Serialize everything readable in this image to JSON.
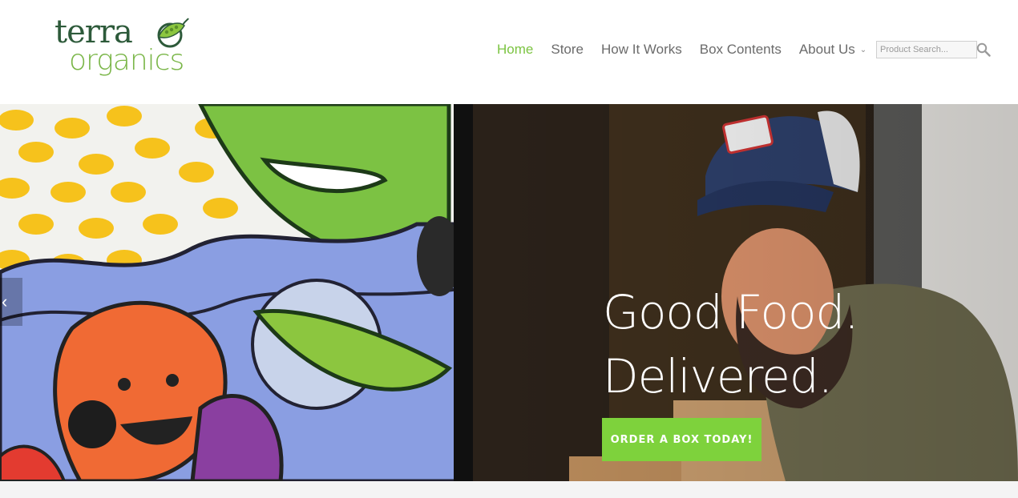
{
  "logo": {
    "line1": "terra",
    "line2": "organics"
  },
  "nav": {
    "items": [
      {
        "label": "Home",
        "active": true
      },
      {
        "label": "Store"
      },
      {
        "label": "How It Works"
      },
      {
        "label": "Box Contents"
      },
      {
        "label": "About Us",
        "has_dropdown": true
      }
    ],
    "dropdown_icon": "chevron-down-icon"
  },
  "search": {
    "placeholder": "Product Search...",
    "icon": "search-icon"
  },
  "hero": {
    "headline_line1": "Good Food.",
    "headline_line2": "Delivered.",
    "cta_label": "ORDER A BOX TODAY!",
    "prev_icon": "chevron-left-icon"
  },
  "colors": {
    "accent_green": "#7ed23c",
    "nav_active": "#7cc442",
    "logo_dark": "#2d5a3a",
    "logo_light": "#7ab648"
  }
}
